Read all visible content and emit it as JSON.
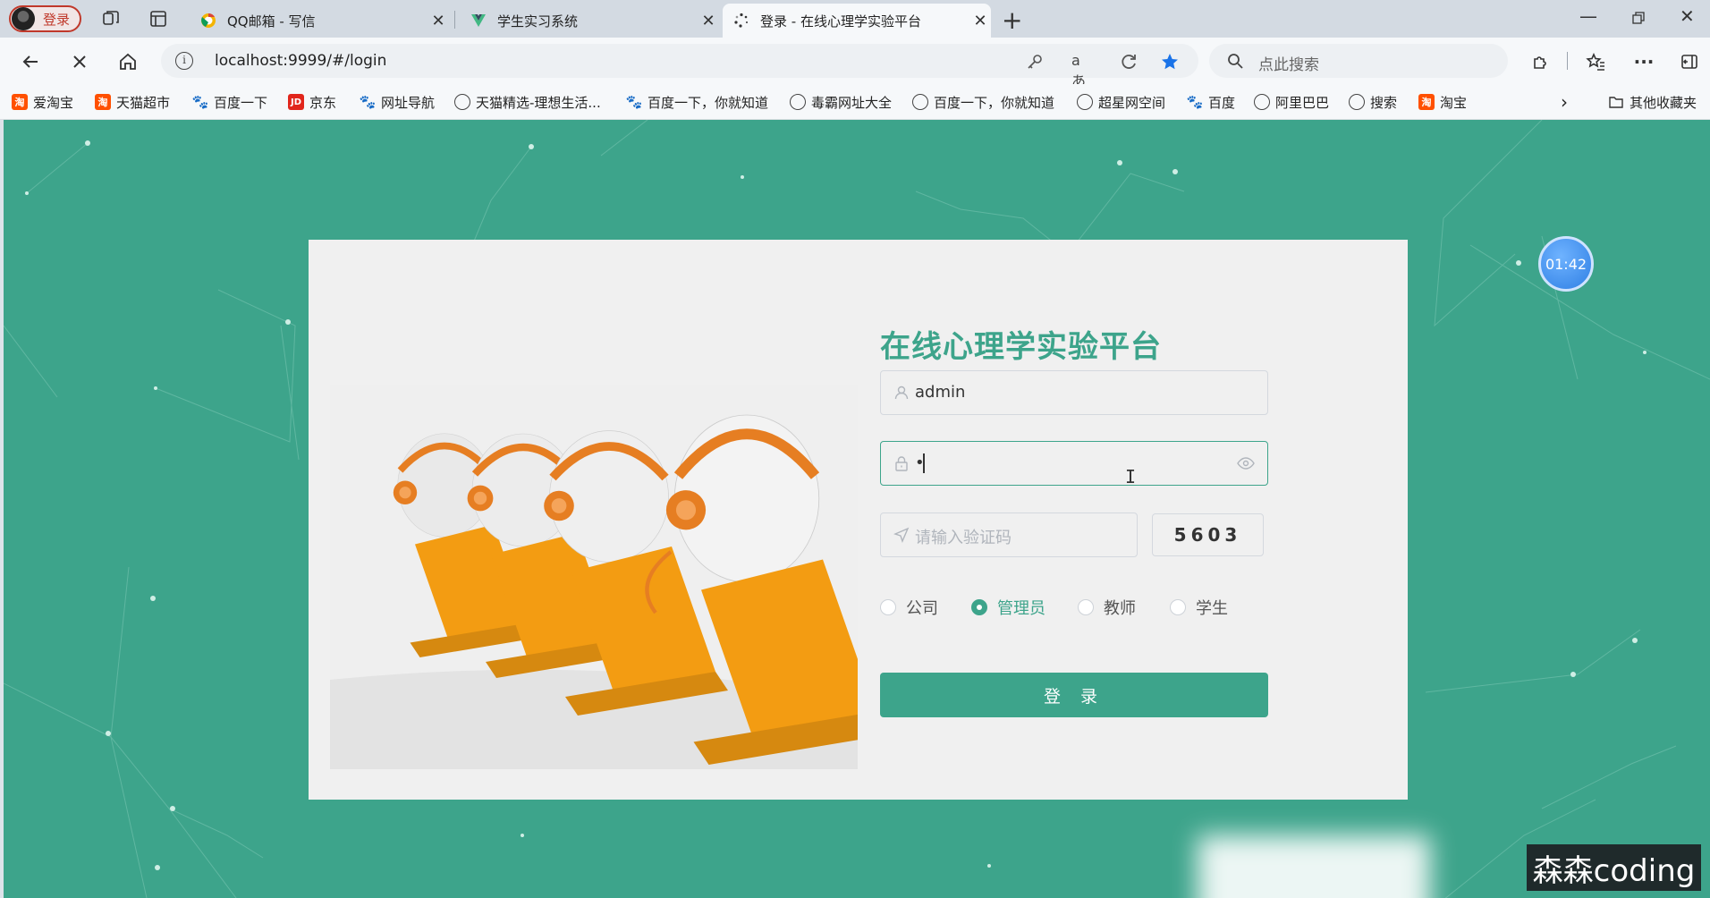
{
  "browser": {
    "profile_label": "登录",
    "tabs": [
      {
        "title": "QQ邮箱 - 写信",
        "active": false
      },
      {
        "title": "学生实习系统",
        "active": false
      },
      {
        "title": "登录 - 在线心理学实验平台",
        "active": true
      }
    ],
    "url": "localhost:9999/#/login",
    "search_placeholder": "点此搜索",
    "bookmarks": [
      {
        "label": "爱淘宝",
        "icon": "taobao-icon"
      },
      {
        "label": "天猫超市",
        "icon": "taobao-icon"
      },
      {
        "label": "百度一下",
        "icon": "baidu-icon"
      },
      {
        "label": "京东",
        "icon": "jd-icon"
      },
      {
        "label": "网址导航",
        "icon": "baidu-icon"
      },
      {
        "label": "天猫精选-理想生活...",
        "icon": "globe-icon"
      },
      {
        "label": "百度一下，你就知道",
        "icon": "baidu-icon"
      },
      {
        "label": "毒霸网址大全",
        "icon": "globe-icon"
      },
      {
        "label": "百度一下，你就知道",
        "icon": "globe-icon"
      },
      {
        "label": "超星网空间",
        "icon": "globe-icon"
      },
      {
        "label": "百度",
        "icon": "baidu-icon"
      },
      {
        "label": "阿里巴巴",
        "icon": "globe-icon"
      },
      {
        "label": "搜索",
        "icon": "globe-icon"
      },
      {
        "label": "淘宝",
        "icon": "taobao-icon"
      }
    ],
    "other_bookmarks": "其他收藏夹"
  },
  "timer": "01:42",
  "login": {
    "title": "在线心理学实验平台",
    "username_value": "admin",
    "password_value": "•",
    "captcha_placeholder": "请输入验证码",
    "captcha_code": "5603",
    "roles": [
      {
        "label": "公司",
        "selected": false
      },
      {
        "label": "管理员",
        "selected": true
      },
      {
        "label": "教师",
        "selected": false
      },
      {
        "label": "学生",
        "selected": false
      }
    ],
    "submit_label": "登 录"
  },
  "watermark": "森森coding",
  "colors": {
    "accent": "#3da48b",
    "timer": "#2f7fe4",
    "profile": "#c0392b"
  }
}
